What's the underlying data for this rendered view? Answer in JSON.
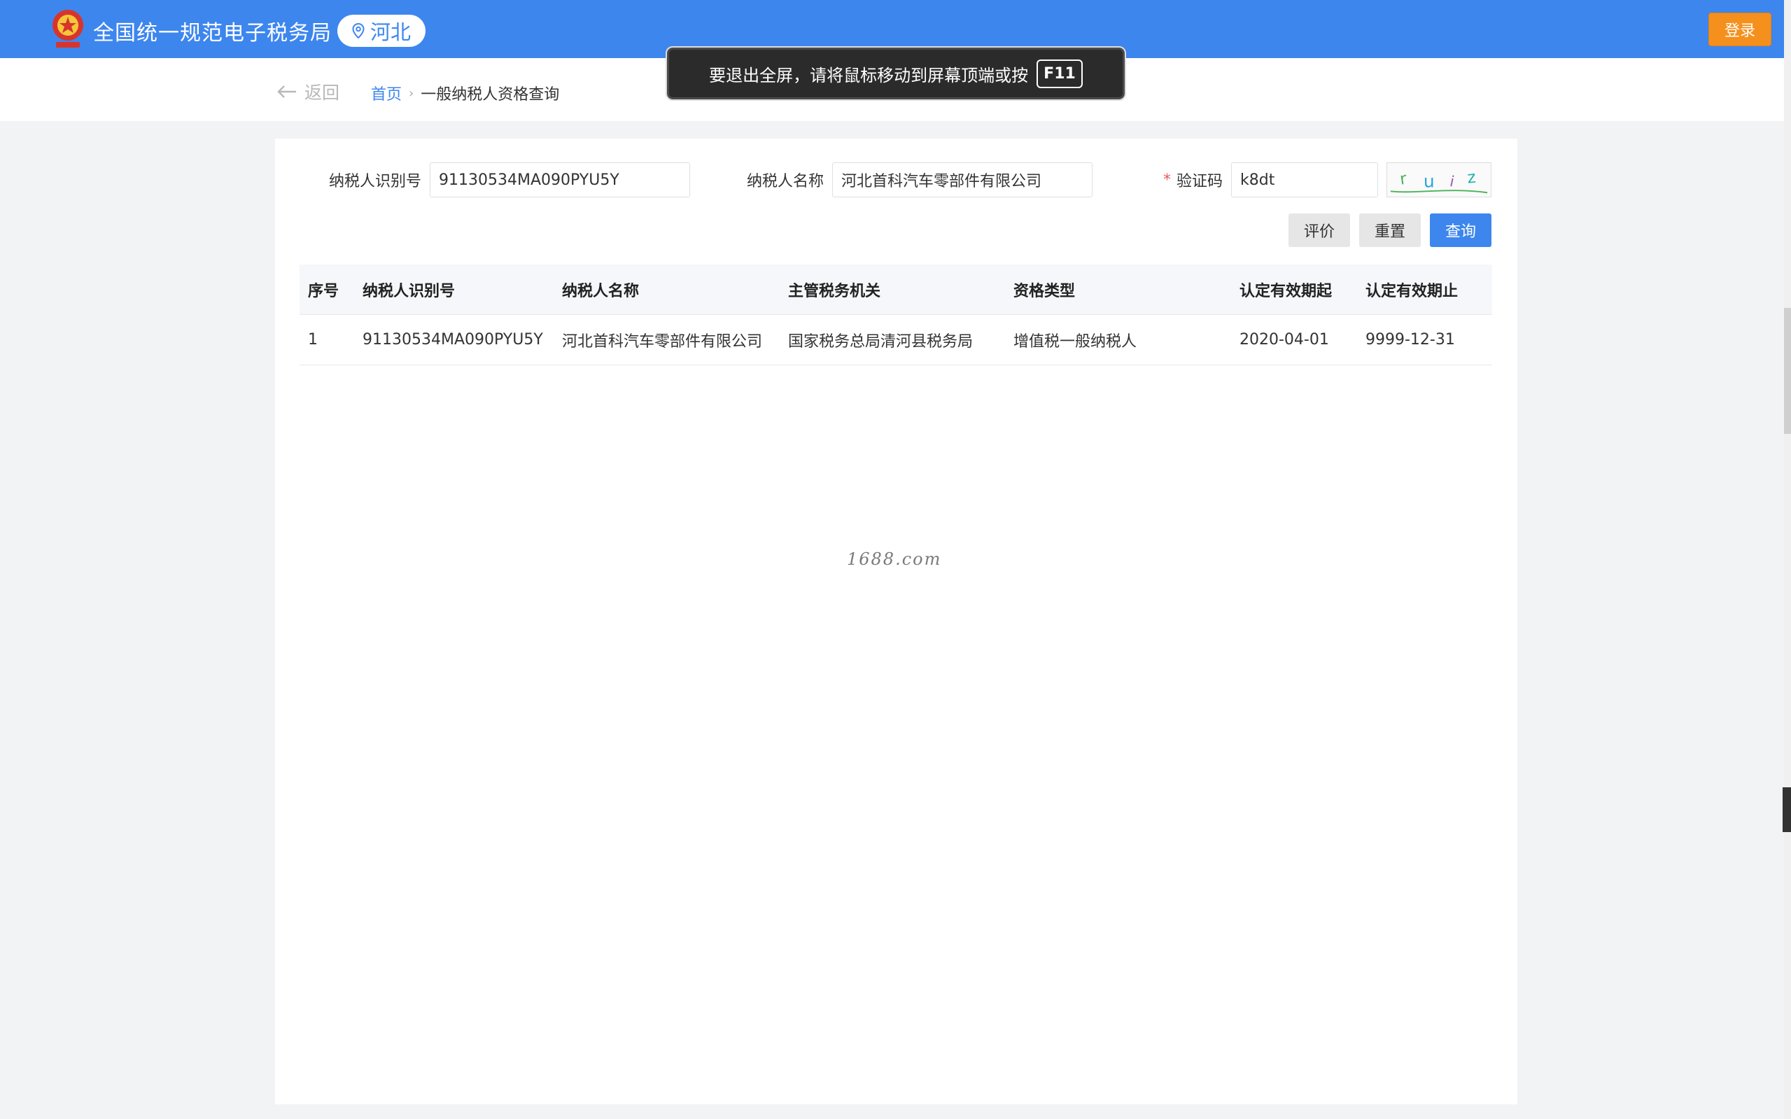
{
  "header": {
    "title": "全国统一规范电子税务局",
    "region": "河北",
    "login_label": "登录"
  },
  "nav": {
    "back_label": "返回",
    "breadcrumb_home": "首页",
    "breadcrumb_current": "一般纳税人资格查询"
  },
  "toast": {
    "message": "要退出全屏，请将鼠标移动到屏幕顶端或按",
    "key": "F11"
  },
  "form": {
    "taxpayer_id_label": "纳税人识别号",
    "taxpayer_id_value": "91130534MA090PYU5Y",
    "taxpayer_name_label": "纳税人名称",
    "taxpayer_name_value": "河北首科汽车零部件有限公司",
    "captcha_label": "验证码",
    "captcha_required_mark": "*",
    "captcha_value": "k8dt",
    "captcha_image_text": "ruiz"
  },
  "buttons": {
    "evaluate": "评价",
    "reset": "重置",
    "query": "查询"
  },
  "table": {
    "headers": [
      "序号",
      "纳税人识别号",
      "纳税人名称",
      "主管税务机关",
      "资格类型",
      "认定有效期起",
      "认定有效期止"
    ],
    "rows": [
      [
        "1",
        "91130534MA090PYU5Y",
        "河北首科汽车零部件有限公司",
        "国家税务总局清河县税务局",
        "增值税一般纳税人",
        "2020-04-01",
        "9999-12-31"
      ]
    ]
  },
  "watermark": "1688.com",
  "colors": {
    "brand_blue": "#3d86ee",
    "login_orange": "#f5901d",
    "required_red": "#e25c5c"
  }
}
